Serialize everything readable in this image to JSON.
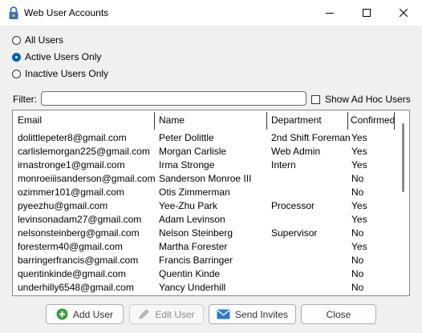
{
  "window": {
    "title": "Web User Accounts"
  },
  "filters": {
    "radios": [
      {
        "label": "All Users",
        "checked": false
      },
      {
        "label": "Active Users Only",
        "checked": true
      },
      {
        "label": "Inactive Users Only",
        "checked": false
      }
    ],
    "filter_label": "Filter:",
    "filter_value": "",
    "adhoc_label": "Show Ad Hoc Users",
    "adhoc_checked": false
  },
  "table": {
    "columns": [
      "Email",
      "Name",
      "Department",
      "Confirmed"
    ],
    "rows": [
      [
        "dolittlepeter8@gmail.com",
        "Peter Dolittle",
        "2nd Shift Foreman",
        "Yes"
      ],
      [
        "carlislemorgan225@gmail.com",
        "Morgan Carlisle",
        "Web Admin",
        "Yes"
      ],
      [
        "irnastronge1@gmail.com",
        "Irma Stronge",
        "Intern",
        "Yes"
      ],
      [
        "monroeiiisanderson@gmail.com",
        "Sanderson Monroe III",
        "",
        "No"
      ],
      [
        "ozimmer101@gmail.com",
        "Otis Zimmerman",
        "",
        "No"
      ],
      [
        "pyeezhu@gmail.com",
        "Yee-Zhu Park",
        "Processor",
        "Yes"
      ],
      [
        "levinsonadam27@gmail.com",
        "Adam Levinson",
        "",
        "Yes"
      ],
      [
        "nelsonsteinberg@gmail.com",
        "Nelson Steinberg",
        "Supervisor",
        "No"
      ],
      [
        "foresterm40@gmail.com",
        "Martha Forester",
        "",
        "Yes"
      ],
      [
        "barringerfrancis@gmail.com",
        "Francis Barringer",
        "",
        "No"
      ],
      [
        "quentinkinde@gmail.com",
        "Quentin Kinde",
        "",
        "No"
      ],
      [
        "underhilly6548@gmail.com",
        "Yancy Underhill",
        "",
        "No"
      ]
    ]
  },
  "buttons": {
    "add": "Add User",
    "edit": "Edit User",
    "send": "Send Invites",
    "close": "Close"
  },
  "colors": {
    "accent": "#005fb8",
    "add_icon": "#3a9a3a",
    "send_icon": "#2b7cd3"
  }
}
